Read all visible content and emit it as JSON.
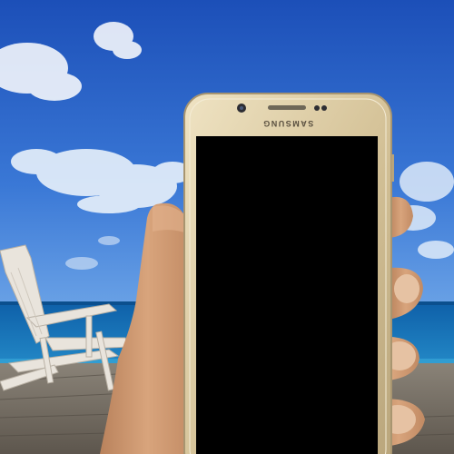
{
  "phone": {
    "brand_text": "SAMSUNG",
    "frame_color": "#d9c9a3",
    "screen_color": "#000000"
  },
  "scene": {
    "sky_color": "#2c63c5",
    "sea_color": "#1f7fc4",
    "deck_color": "#7c7368",
    "icons": [
      "deck-chair-icon",
      "hand-icon",
      "smartphone-icon",
      "cloud-icon"
    ]
  }
}
